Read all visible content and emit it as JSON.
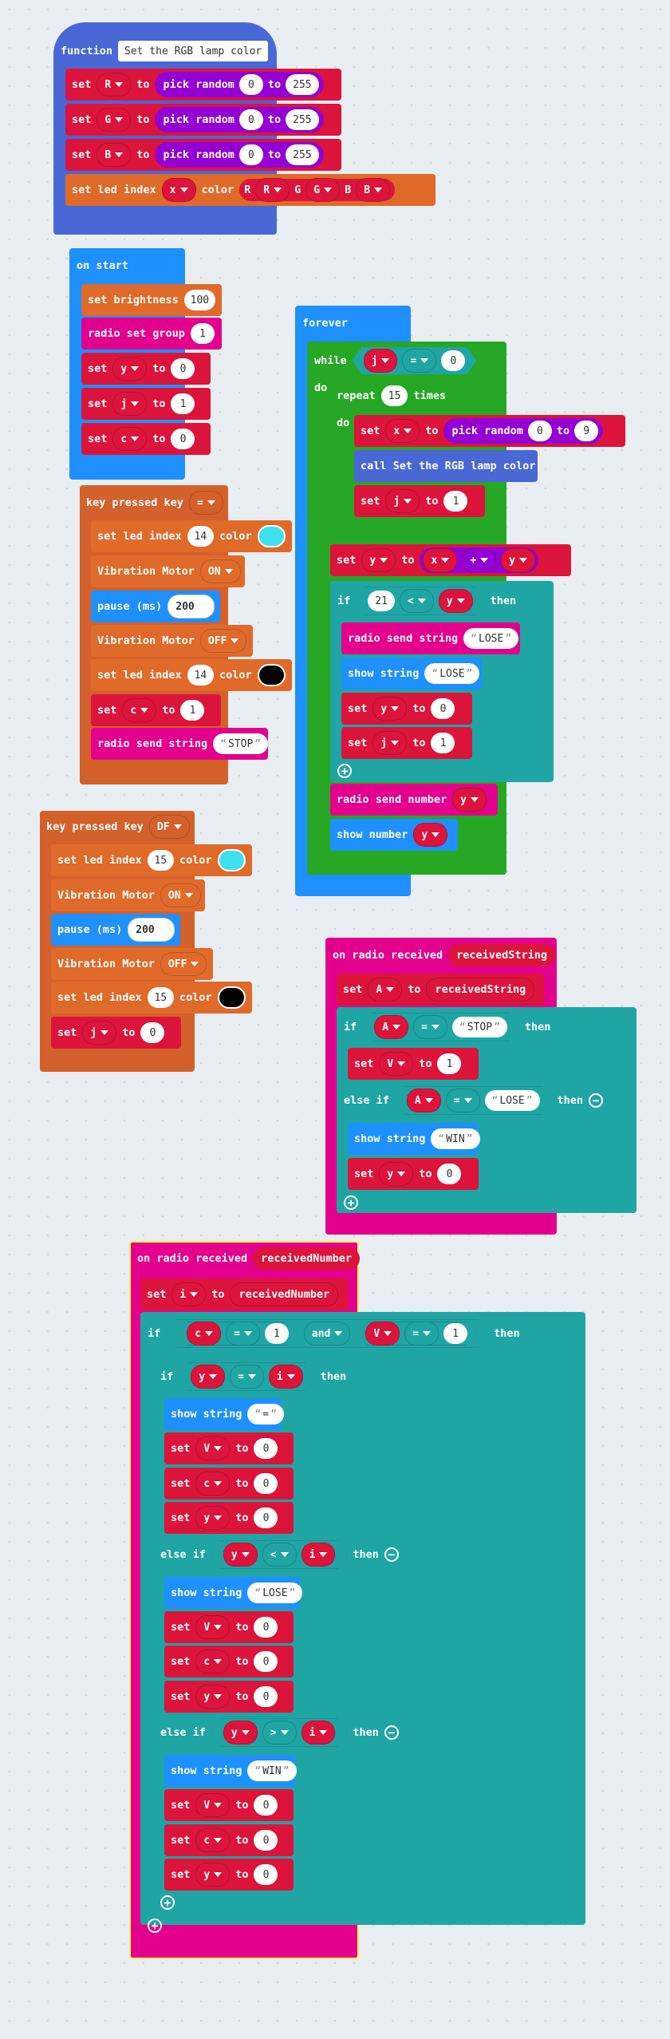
{
  "colors": {
    "function": "#4a67d6",
    "variables": "#dc143c",
    "math": "#9400d3",
    "led": "#e06a2a",
    "basic": "#1e90ff",
    "radio": "#e3008c",
    "loops": "#26a826",
    "logic": "#20a5a5",
    "input": "#d4602c"
  },
  "vals": {
    "0": "0",
    "1": "1",
    "9": "9",
    "14": "14",
    "15": "15",
    "21": "21",
    "100": "100",
    "200": "200",
    "255": "255"
  },
  "vars": {
    "R": "R",
    "G": "G",
    "B": "B",
    "x": "x",
    "y": "y",
    "j": "j",
    "c": "c",
    "A": "A",
    "V": "V",
    "i": "i"
  },
  "kw": {
    "set": "set",
    "to": "to",
    "pick_random": "pick random",
    "color": "color",
    "set_led_index": "set led index",
    "pause": "pause (ms)",
    "vibration": "Vibration Motor",
    "on": "ON",
    "off": "OFF",
    "radio_send_string": "radio send string",
    "show_string": "show string",
    "if": "if",
    "then": "then",
    "else_if": "else if",
    "do": "do",
    "while": "while",
    "repeat": "repeat",
    "times": "times",
    "eq": "=",
    "lt": "<",
    "gt": ">",
    "plus": "+",
    "and": "and",
    "key_pressed": "key pressed key"
  },
  "function_block": {
    "keyword": "function",
    "name": "Set the RGB lamp color",
    "led_label_r": "R",
    "led_label_g": "G",
    "led_label_b": "B"
  },
  "on_start": {
    "header": "on start",
    "set_brightness": "set brightness",
    "radio_set_group": "radio set group"
  },
  "forever": {
    "header": "forever",
    "call": "call Set the RGB lamp color",
    "radio_send_number": "radio send number",
    "show_number": "show number",
    "str_lose": "LOSE"
  },
  "key1": {
    "key": "="
  },
  "key2": {
    "key": "DF"
  },
  "strings": {
    "stop": "STOP",
    "lose": "LOSE",
    "win": "WIN",
    "eq": "="
  },
  "radio_string": {
    "header": "on radio received",
    "param": "receivedString"
  },
  "radio_number": {
    "header": "on radio received",
    "param": "receivedNumber"
  }
}
